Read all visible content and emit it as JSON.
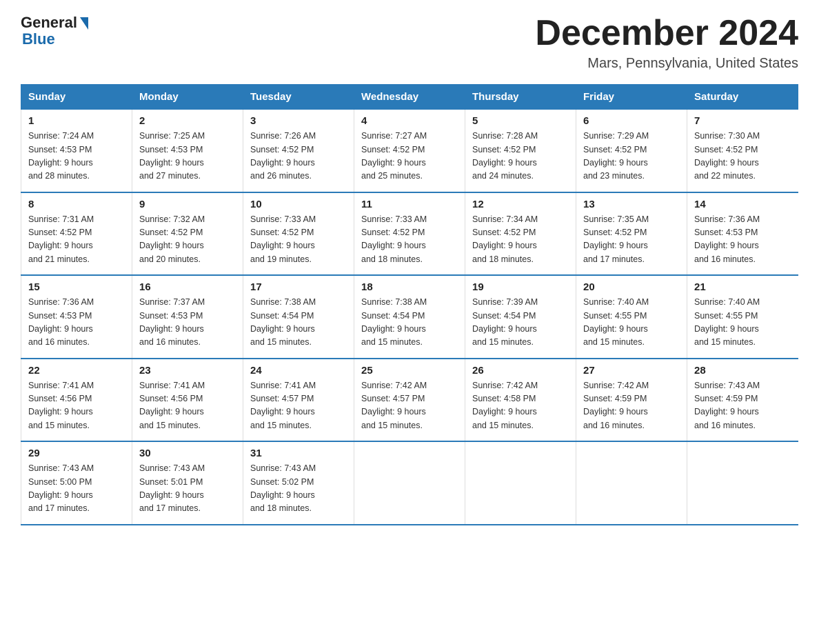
{
  "logo": {
    "general": "General",
    "blue": "Blue"
  },
  "title": {
    "month_year": "December 2024",
    "location": "Mars, Pennsylvania, United States"
  },
  "days_of_week": [
    "Sunday",
    "Monday",
    "Tuesday",
    "Wednesday",
    "Thursday",
    "Friday",
    "Saturday"
  ],
  "weeks": [
    [
      {
        "day": "1",
        "sunrise": "7:24 AM",
        "sunset": "4:53 PM",
        "daylight": "9 hours and 28 minutes."
      },
      {
        "day": "2",
        "sunrise": "7:25 AM",
        "sunset": "4:53 PM",
        "daylight": "9 hours and 27 minutes."
      },
      {
        "day": "3",
        "sunrise": "7:26 AM",
        "sunset": "4:52 PM",
        "daylight": "9 hours and 26 minutes."
      },
      {
        "day": "4",
        "sunrise": "7:27 AM",
        "sunset": "4:52 PM",
        "daylight": "9 hours and 25 minutes."
      },
      {
        "day": "5",
        "sunrise": "7:28 AM",
        "sunset": "4:52 PM",
        "daylight": "9 hours and 24 minutes."
      },
      {
        "day": "6",
        "sunrise": "7:29 AM",
        "sunset": "4:52 PM",
        "daylight": "9 hours and 23 minutes."
      },
      {
        "day": "7",
        "sunrise": "7:30 AM",
        "sunset": "4:52 PM",
        "daylight": "9 hours and 22 minutes."
      }
    ],
    [
      {
        "day": "8",
        "sunrise": "7:31 AM",
        "sunset": "4:52 PM",
        "daylight": "9 hours and 21 minutes."
      },
      {
        "day": "9",
        "sunrise": "7:32 AM",
        "sunset": "4:52 PM",
        "daylight": "9 hours and 20 minutes."
      },
      {
        "day": "10",
        "sunrise": "7:33 AM",
        "sunset": "4:52 PM",
        "daylight": "9 hours and 19 minutes."
      },
      {
        "day": "11",
        "sunrise": "7:33 AM",
        "sunset": "4:52 PM",
        "daylight": "9 hours and 18 minutes."
      },
      {
        "day": "12",
        "sunrise": "7:34 AM",
        "sunset": "4:52 PM",
        "daylight": "9 hours and 18 minutes."
      },
      {
        "day": "13",
        "sunrise": "7:35 AM",
        "sunset": "4:52 PM",
        "daylight": "9 hours and 17 minutes."
      },
      {
        "day": "14",
        "sunrise": "7:36 AM",
        "sunset": "4:53 PM",
        "daylight": "9 hours and 16 minutes."
      }
    ],
    [
      {
        "day": "15",
        "sunrise": "7:36 AM",
        "sunset": "4:53 PM",
        "daylight": "9 hours and 16 minutes."
      },
      {
        "day": "16",
        "sunrise": "7:37 AM",
        "sunset": "4:53 PM",
        "daylight": "9 hours and 16 minutes."
      },
      {
        "day": "17",
        "sunrise": "7:38 AM",
        "sunset": "4:54 PM",
        "daylight": "9 hours and 15 minutes."
      },
      {
        "day": "18",
        "sunrise": "7:38 AM",
        "sunset": "4:54 PM",
        "daylight": "9 hours and 15 minutes."
      },
      {
        "day": "19",
        "sunrise": "7:39 AM",
        "sunset": "4:54 PM",
        "daylight": "9 hours and 15 minutes."
      },
      {
        "day": "20",
        "sunrise": "7:40 AM",
        "sunset": "4:55 PM",
        "daylight": "9 hours and 15 minutes."
      },
      {
        "day": "21",
        "sunrise": "7:40 AM",
        "sunset": "4:55 PM",
        "daylight": "9 hours and 15 minutes."
      }
    ],
    [
      {
        "day": "22",
        "sunrise": "7:41 AM",
        "sunset": "4:56 PM",
        "daylight": "9 hours and 15 minutes."
      },
      {
        "day": "23",
        "sunrise": "7:41 AM",
        "sunset": "4:56 PM",
        "daylight": "9 hours and 15 minutes."
      },
      {
        "day": "24",
        "sunrise": "7:41 AM",
        "sunset": "4:57 PM",
        "daylight": "9 hours and 15 minutes."
      },
      {
        "day": "25",
        "sunrise": "7:42 AM",
        "sunset": "4:57 PM",
        "daylight": "9 hours and 15 minutes."
      },
      {
        "day": "26",
        "sunrise": "7:42 AM",
        "sunset": "4:58 PM",
        "daylight": "9 hours and 15 minutes."
      },
      {
        "day": "27",
        "sunrise": "7:42 AM",
        "sunset": "4:59 PM",
        "daylight": "9 hours and 16 minutes."
      },
      {
        "day": "28",
        "sunrise": "7:43 AM",
        "sunset": "4:59 PM",
        "daylight": "9 hours and 16 minutes."
      }
    ],
    [
      {
        "day": "29",
        "sunrise": "7:43 AM",
        "sunset": "5:00 PM",
        "daylight": "9 hours and 17 minutes."
      },
      {
        "day": "30",
        "sunrise": "7:43 AM",
        "sunset": "5:01 PM",
        "daylight": "9 hours and 17 minutes."
      },
      {
        "day": "31",
        "sunrise": "7:43 AM",
        "sunset": "5:02 PM",
        "daylight": "9 hours and 18 minutes."
      },
      null,
      null,
      null,
      null
    ]
  ],
  "labels": {
    "sunrise": "Sunrise:",
    "sunset": "Sunset:",
    "daylight": "Daylight:"
  }
}
